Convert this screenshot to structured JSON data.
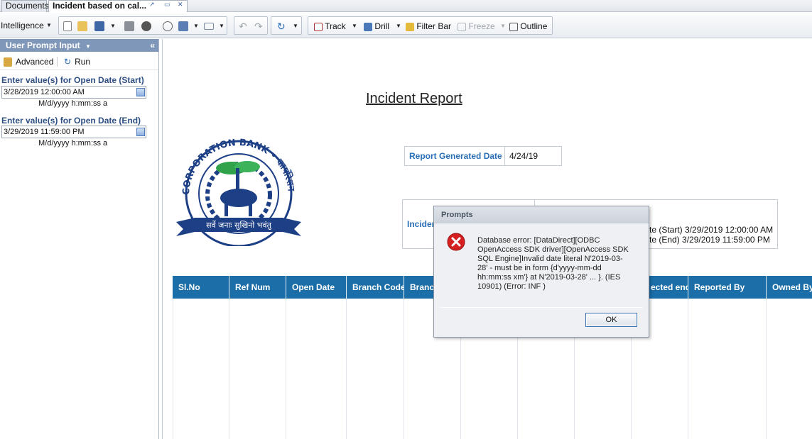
{
  "tabs": {
    "documents": "Documents",
    "report": "Incident based on cal..."
  },
  "toolbar": {
    "intelligence": "Intelligence",
    "track": "Track",
    "drill": "Drill",
    "filter_bar": "Filter Bar",
    "freeze": "Freeze",
    "outline": "Outline"
  },
  "left_panel": {
    "title": "User Prompt Input",
    "advanced": "Advanced",
    "run": "Run",
    "prompts": [
      {
        "label": "Enter value(s) for Open Date (Start)",
        "value": "3/28/2019 12:00:00 AM",
        "format": "M/d/yyyy h:mm:ss a"
      },
      {
        "label": "Enter value(s) for Open Date (End)",
        "value": "3/29/2019 11:59:00 PM",
        "format": "M/d/yyyy h:mm:ss a"
      }
    ]
  },
  "report": {
    "title": "Incident Report",
    "logo": {
      "arc_text": "CORPORATION BANK • कार्पोरेशन बैंक",
      "banner": "सर्वे जनाः सुखिनो भवंतु"
    },
    "generated_label": "Report Generated Date",
    "generated_value": "4/24/19",
    "incident_label": "Inciden",
    "filter_start": "te (Start) 3/29/2019 12:00:00 AM",
    "filter_end": "te (End) 3/29/2019 11:59:00 PM",
    "columns": [
      "Sl.No",
      "Ref Num",
      "Open Date",
      "Branch Code",
      "Branc",
      "",
      "",
      "",
      "ected end",
      "Reported By",
      "Owned By"
    ]
  },
  "dialog": {
    "title": "Prompts",
    "message": "Database error: [DataDirect][ODBC OpenAccess SDK driver][OpenAccess SDK SQL Engine]Invalid date literal N'2019-03-28' - must be in form {d'yyyy-mm-dd hh:mm:ss xm'} at N'2019-03-28' ... }. (IES 10901) (Error: INF )",
    "ok_label": "OK"
  },
  "colors": {
    "grid_header": "#1b6ea8",
    "label_blue": "#2a6fb5",
    "panel_header": "#7f97b8",
    "error_red": "#d42020"
  }
}
